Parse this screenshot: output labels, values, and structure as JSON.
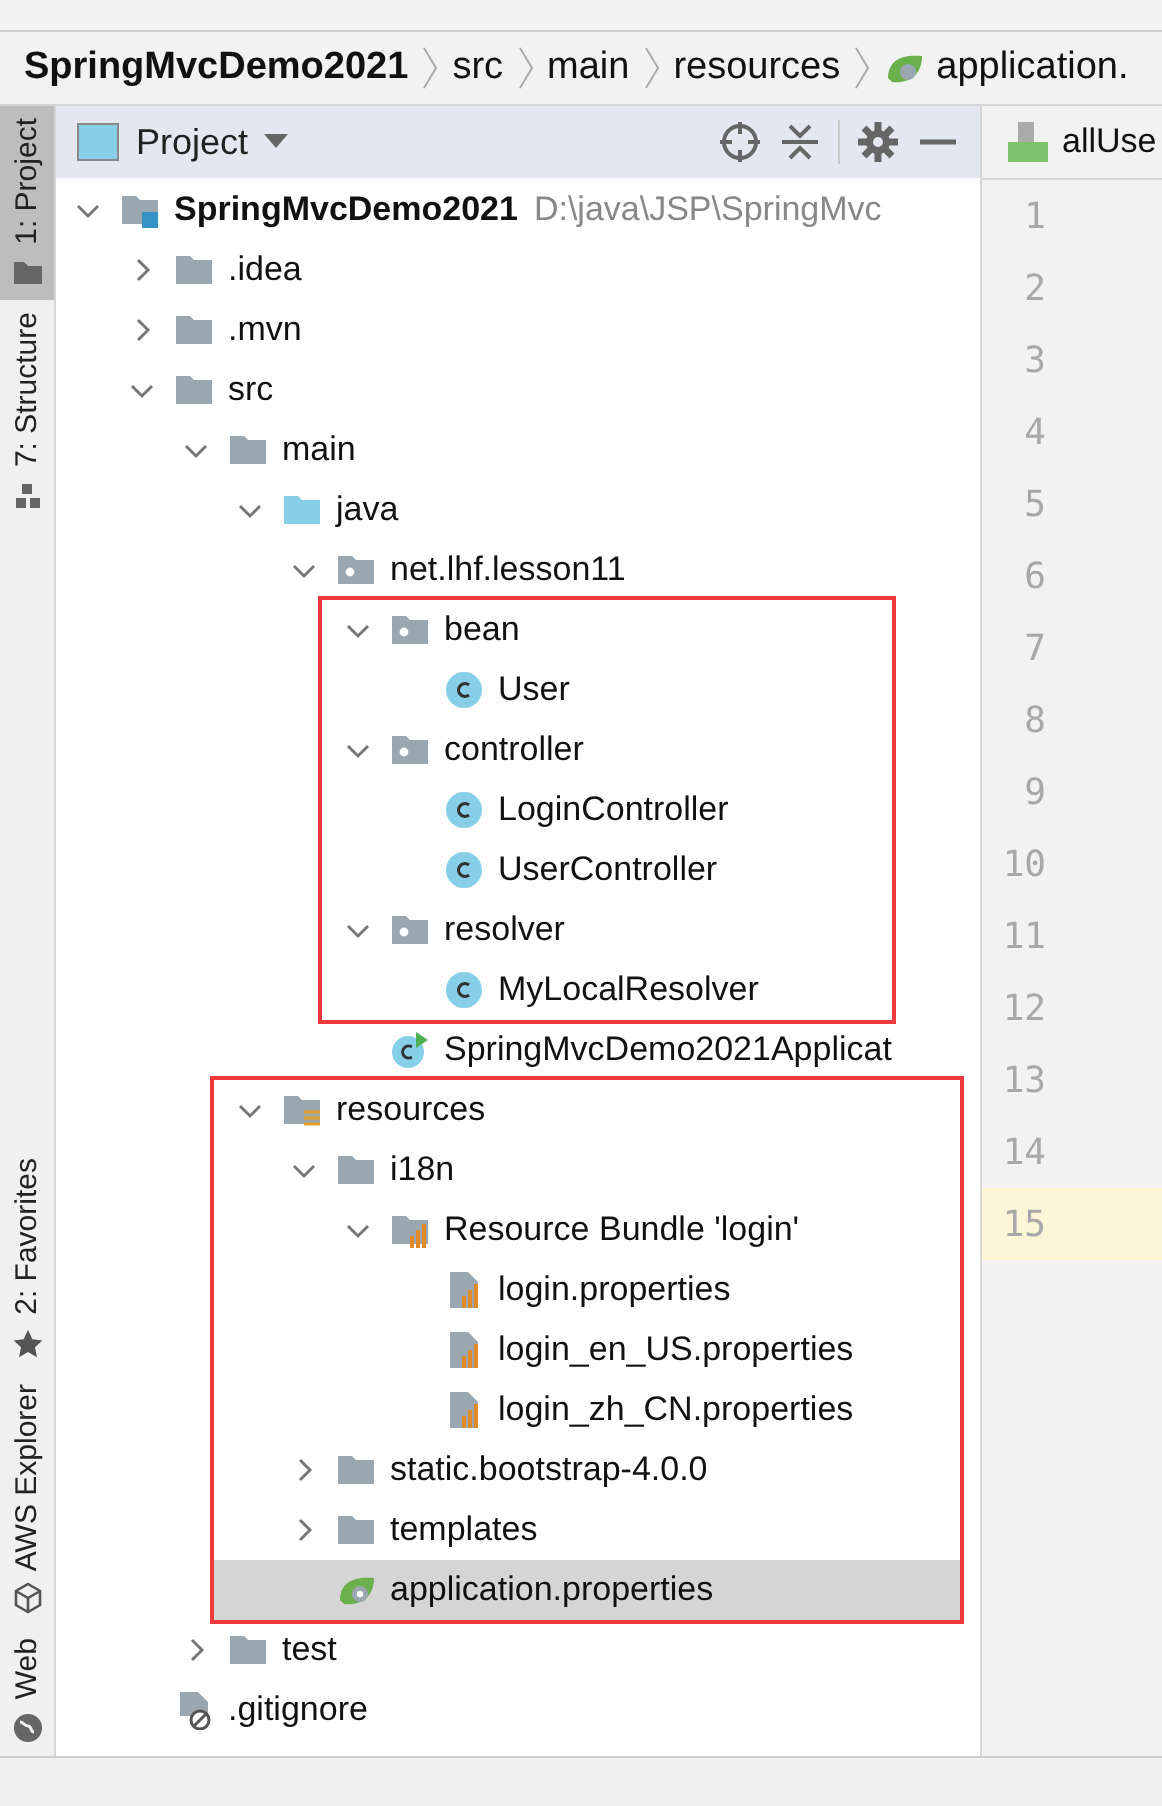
{
  "breadcrumb": [
    {
      "label": "SpringMvcDemo2021",
      "kind": "project"
    },
    {
      "label": "src",
      "kind": "plain"
    },
    {
      "label": "main",
      "kind": "plain"
    },
    {
      "label": "resources",
      "kind": "plain"
    },
    {
      "label": "application.",
      "kind": "spring"
    }
  ],
  "tool_strip": [
    {
      "label": "1: Project",
      "selected": true,
      "kind": "folder"
    },
    {
      "label": "7: Structure",
      "selected": false,
      "kind": "structure"
    },
    {
      "label": "2: Favorites",
      "selected": false,
      "kind": "star"
    },
    {
      "label": "AWS Explorer",
      "selected": false,
      "kind": "cube"
    },
    {
      "label": "Web",
      "selected": false,
      "kind": "globe"
    }
  ],
  "project_panel": {
    "title": "Project",
    "tree": [
      {
        "label": "SpringMvcDemo2021",
        "path": "D:\\java\\JSP\\SpringMvc",
        "kind": "module",
        "expanded": true,
        "selected": false,
        "children": [
          {
            "label": ".idea",
            "kind": "folder",
            "expanded": false,
            "selected": false
          },
          {
            "label": ".mvn",
            "kind": "folder",
            "expanded": false,
            "selected": false
          },
          {
            "label": "src",
            "kind": "folder",
            "expanded": true,
            "selected": false,
            "children": [
              {
                "label": "main",
                "kind": "folder",
                "expanded": true,
                "selected": false,
                "children": [
                  {
                    "label": "java",
                    "kind": "source",
                    "expanded": true,
                    "selected": false,
                    "children": [
                      {
                        "label": "net.lhf.lesson11",
                        "kind": "package",
                        "expanded": true,
                        "selected": false,
                        "children": [
                          {
                            "label": "bean",
                            "kind": "package",
                            "expanded": true,
                            "selected": false,
                            "boxed": true,
                            "children": [
                              {
                                "label": "User",
                                "kind": "class",
                                "selected": false
                              }
                            ]
                          },
                          {
                            "label": "controller",
                            "kind": "package",
                            "expanded": true,
                            "selected": false,
                            "boxed": true,
                            "children": [
                              {
                                "label": "LoginController",
                                "kind": "class",
                                "selected": false
                              },
                              {
                                "label": "UserController",
                                "kind": "class",
                                "selected": false
                              }
                            ]
                          },
                          {
                            "label": "resolver",
                            "kind": "package",
                            "expanded": true,
                            "selected": false,
                            "boxed": true,
                            "children": [
                              {
                                "label": "MyLocalResolver",
                                "kind": "class",
                                "selected": false
                              }
                            ]
                          },
                          {
                            "label": "SpringMvcDemo2021Applicat",
                            "kind": "springclass",
                            "selected": false
                          }
                        ]
                      }
                    ]
                  },
                  {
                    "label": "resources",
                    "kind": "resources",
                    "expanded": true,
                    "selected": false,
                    "boxed": true,
                    "children": [
                      {
                        "label": "i18n",
                        "kind": "folder",
                        "expanded": true,
                        "selected": false,
                        "children": [
                          {
                            "label": "Resource Bundle 'login'",
                            "kind": "bundle",
                            "expanded": true,
                            "selected": false,
                            "children": [
                              {
                                "label": "login.properties",
                                "kind": "properties",
                                "selected": false
                              },
                              {
                                "label": "login_en_US.properties",
                                "kind": "properties",
                                "selected": false
                              },
                              {
                                "label": "login_zh_CN.properties",
                                "kind": "properties",
                                "selected": false
                              }
                            ]
                          }
                        ]
                      },
                      {
                        "label": "static.bootstrap-4.0.0",
                        "kind": "folder",
                        "expanded": false,
                        "selected": false
                      },
                      {
                        "label": "templates",
                        "kind": "folder",
                        "expanded": false,
                        "selected": false
                      },
                      {
                        "label": "application.properties",
                        "kind": "springprops",
                        "selected": true
                      }
                    ]
                  }
                ]
              },
              {
                "label": "test",
                "kind": "folder",
                "expanded": false,
                "selected": false
              }
            ]
          },
          {
            "label": ".gitignore",
            "kind": "ignore",
            "selected": false
          }
        ]
      }
    ]
  },
  "editor": {
    "tab": "allUse",
    "lines": [
      {
        "number": "1",
        "current": false
      },
      {
        "number": "2",
        "current": false
      },
      {
        "number": "3",
        "current": false
      },
      {
        "number": "4",
        "current": false
      },
      {
        "number": "5",
        "current": false
      },
      {
        "number": "6",
        "current": false
      },
      {
        "number": "7",
        "current": false
      },
      {
        "number": "8",
        "current": false
      },
      {
        "number": "9",
        "current": false
      },
      {
        "number": "10",
        "current": false
      },
      {
        "number": "11",
        "current": false
      },
      {
        "number": "12",
        "current": false
      },
      {
        "number": "13",
        "current": false
      },
      {
        "number": "14",
        "current": false
      },
      {
        "number": "15",
        "current": true
      }
    ]
  }
}
